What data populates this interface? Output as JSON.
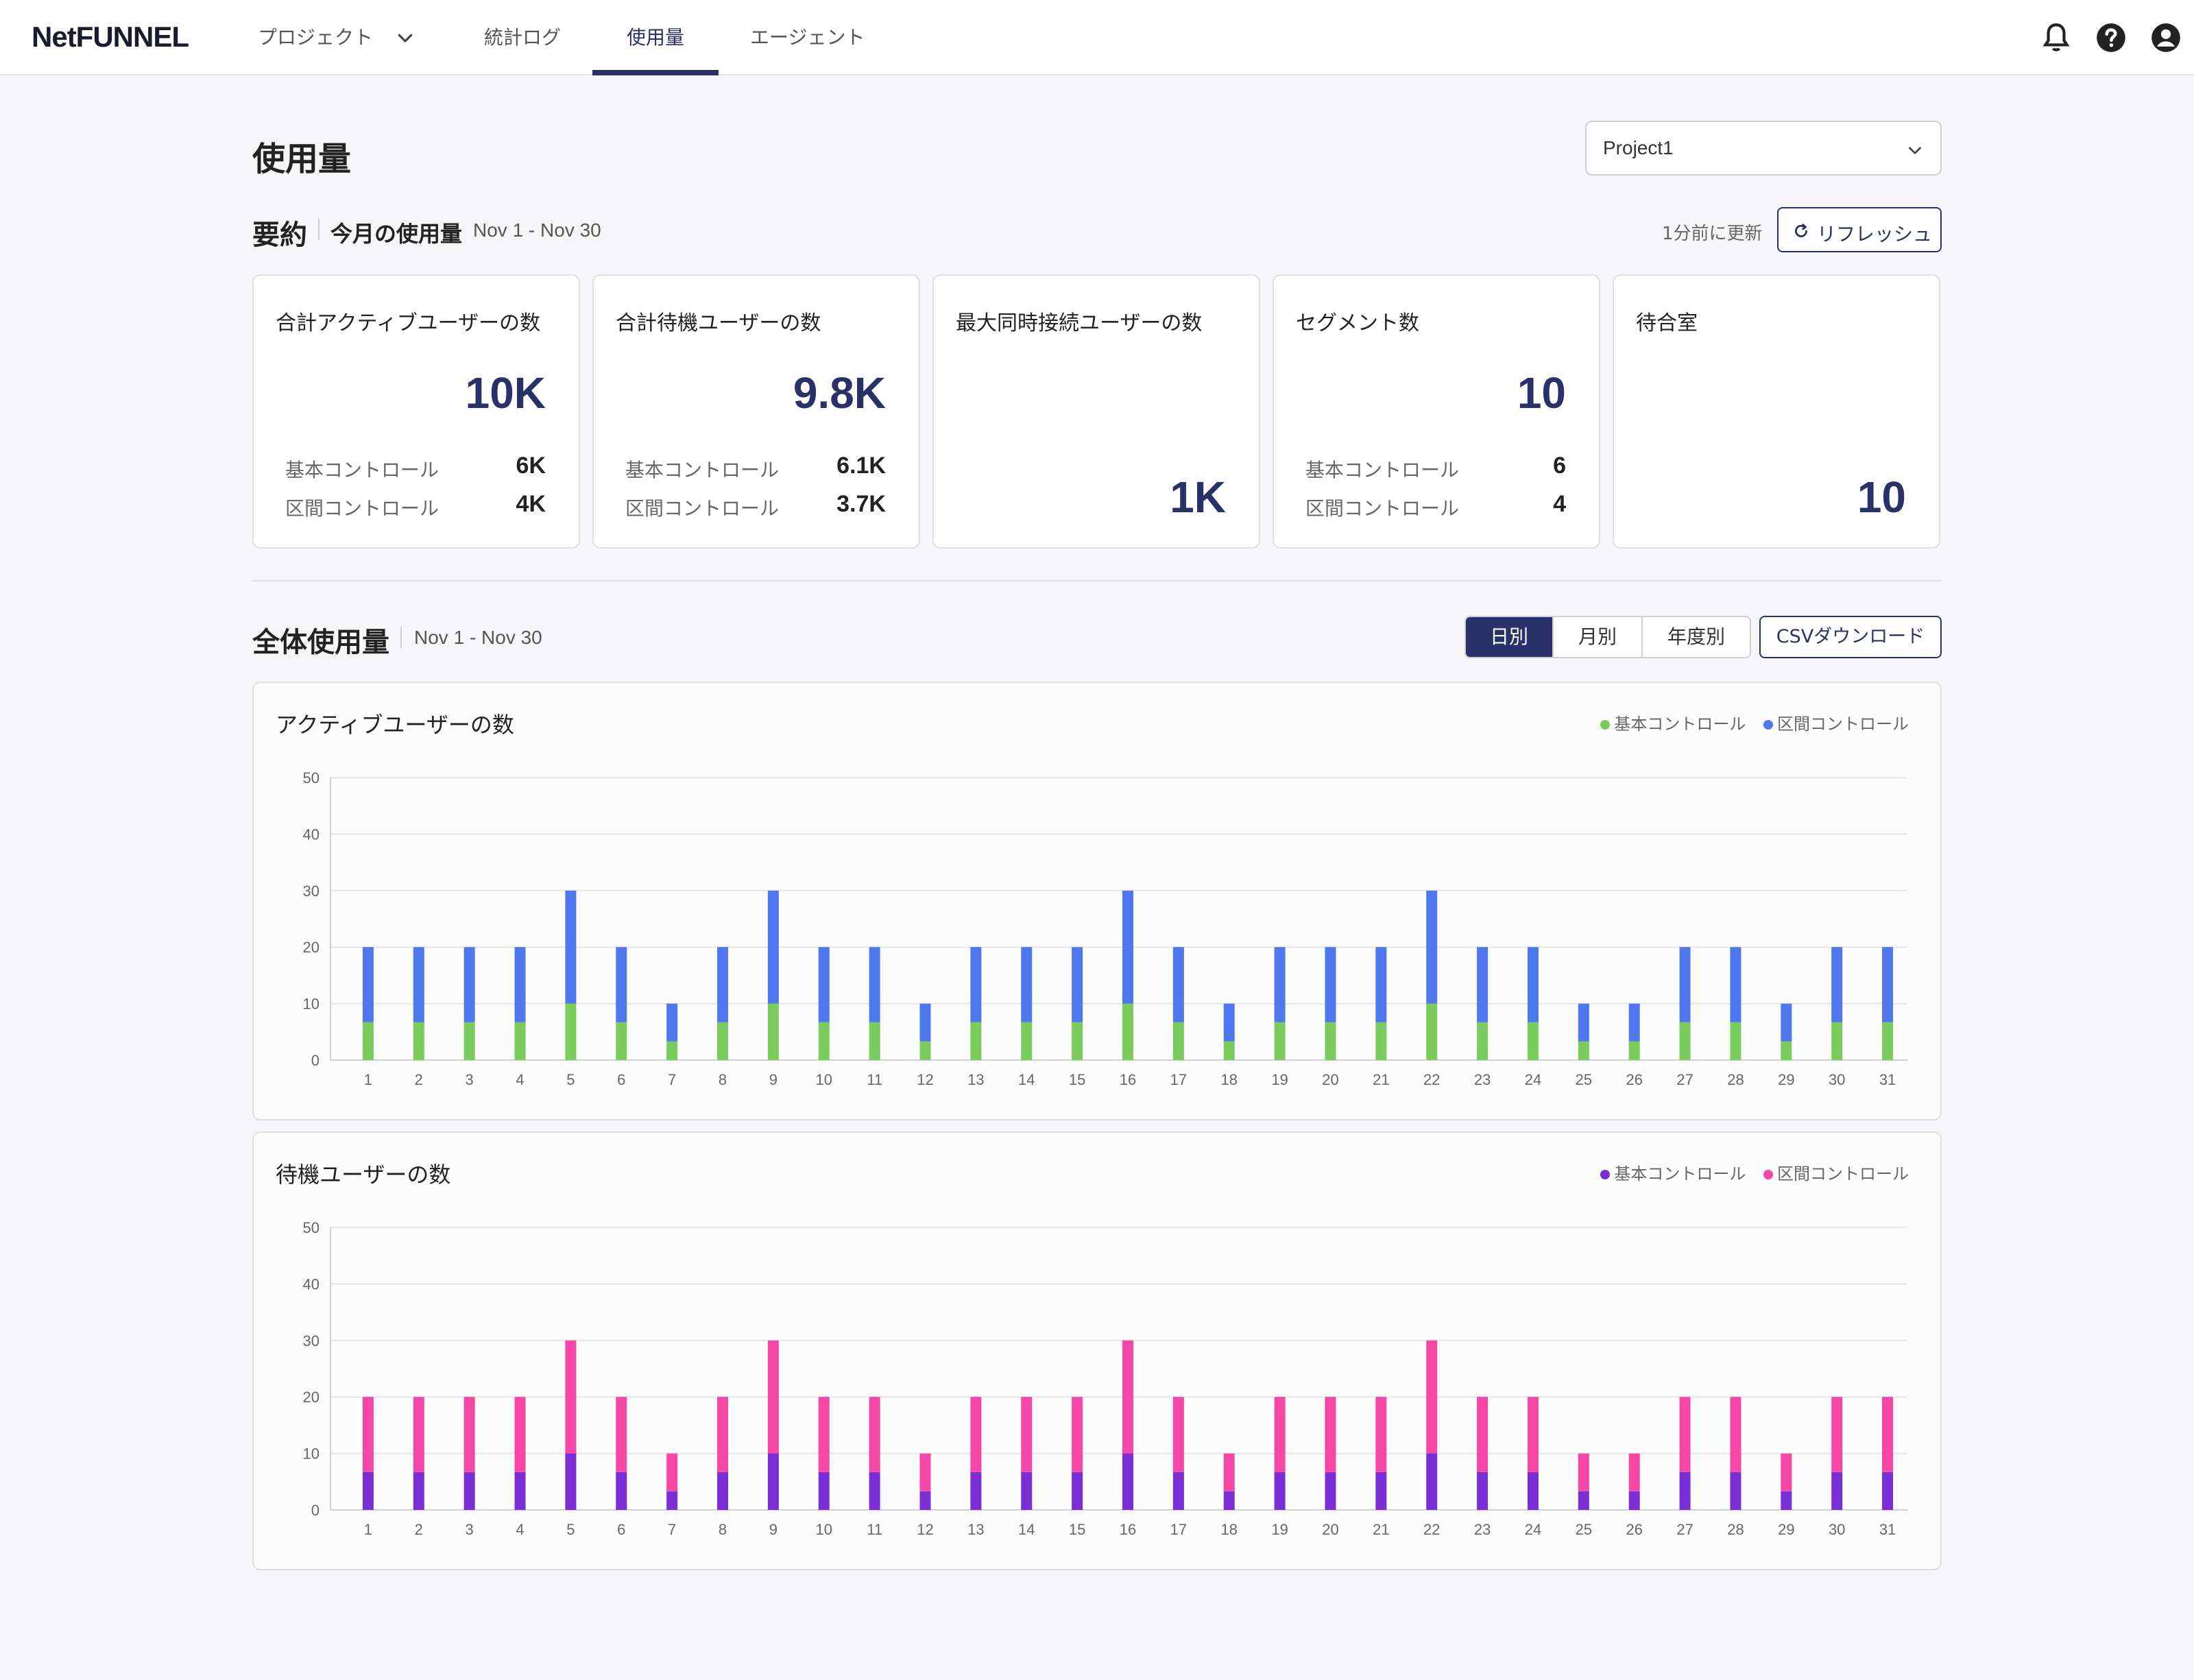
{
  "nav": {
    "logo": "NetFUNNEL",
    "items": [
      {
        "label": "プロジェクト",
        "left": 376
      },
      {
        "label": "統計ログ"
      },
      {
        "label": "使用量"
      },
      {
        "label": "エージェント"
      }
    ]
  },
  "page": {
    "title": "使用量",
    "project_select": "Project1"
  },
  "summary": {
    "heading": "要約",
    "sub": "今月の使用量",
    "range": "Nov 1 - Nov 30",
    "updated": "1分前に更新",
    "refresh_label": "リフレッシュ",
    "cards": [
      {
        "title": "合計アクティブユーザーの数",
        "value": "10K",
        "rows": [
          {
            "label": "基本コントロール",
            "value": "6K"
          },
          {
            "label": "区間コントロール",
            "value": "4K"
          }
        ]
      },
      {
        "title": "合計待機ユーザーの数",
        "value": "9.8K",
        "rows": [
          {
            "label": "基本コントロール",
            "value": "6.1K"
          },
          {
            "label": "区間コントロール",
            "value": "3.7K"
          }
        ]
      },
      {
        "title": "最大同時接続ユーザーの数",
        "value": "1K",
        "rows": []
      },
      {
        "title": "セグメント数",
        "value": "10",
        "rows": [
          {
            "label": "基本コントロール",
            "value": "6"
          },
          {
            "label": "区間コントロール",
            "value": "4"
          }
        ]
      },
      {
        "title": "待合室",
        "value": "10",
        "rows": []
      }
    ]
  },
  "overall": {
    "heading": "全体使用量",
    "range": "Nov 1 - Nov 30",
    "toggle": [
      "日別",
      "月別",
      "年度別"
    ],
    "csv_label": "CSVダウンロード"
  },
  "colors": {
    "accent": "#2a3168",
    "active_basic": "#7acc5c",
    "active_section": "#4f77ee",
    "wait_basic": "#7a2fd6",
    "wait_section": "#f646a6"
  },
  "chart_data": [
    {
      "type": "bar",
      "stacked": true,
      "title": "アクティブユーザーの数",
      "categories": [
        "1",
        "2",
        "3",
        "4",
        "5",
        "6",
        "7",
        "8",
        "9",
        "10",
        "11",
        "12",
        "13",
        "14",
        "15",
        "16",
        "17",
        "18",
        "19",
        "20",
        "21",
        "22",
        "23",
        "24",
        "25",
        "26",
        "27",
        "28",
        "29",
        "30",
        "31"
      ],
      "series": [
        {
          "name": "基本コントロール",
          "color": "#7acc5c",
          "values": [
            6.7,
            6.7,
            6.7,
            6.7,
            10,
            6.7,
            3.3,
            6.7,
            10,
            6.7,
            6.7,
            3.3,
            6.7,
            6.7,
            6.7,
            10,
            6.7,
            3.3,
            6.7,
            6.7,
            6.7,
            10,
            6.7,
            6.7,
            3.3,
            3.3,
            6.7,
            6.7,
            3.3,
            6.7,
            6.7
          ]
        },
        {
          "name": "区間コントロール",
          "color": "#4f77ee",
          "values": [
            13.3,
            13.3,
            13.3,
            13.3,
            20,
            13.3,
            6.7,
            13.3,
            20,
            13.3,
            13.3,
            6.7,
            13.3,
            13.3,
            13.3,
            20,
            13.3,
            6.7,
            13.3,
            13.3,
            13.3,
            20,
            13.3,
            13.3,
            6.7,
            6.7,
            13.3,
            13.3,
            6.7,
            13.3,
            13.3
          ]
        }
      ],
      "yticks": [
        0,
        10,
        20,
        30,
        40,
        50
      ],
      "ylim": [
        0,
        50
      ],
      "grid": true,
      "legend": "top-right"
    },
    {
      "type": "bar",
      "stacked": true,
      "title": "待機ユーザーの数",
      "categories": [
        "1",
        "2",
        "3",
        "4",
        "5",
        "6",
        "7",
        "8",
        "9",
        "10",
        "11",
        "12",
        "13",
        "14",
        "15",
        "16",
        "17",
        "18",
        "19",
        "20",
        "21",
        "22",
        "23",
        "24",
        "25",
        "26",
        "27",
        "28",
        "29",
        "30",
        "31"
      ],
      "series": [
        {
          "name": "基本コントロール",
          "color": "#7a2fd6",
          "values": [
            6.7,
            6.7,
            6.7,
            6.7,
            10,
            6.7,
            3.3,
            6.7,
            10,
            6.7,
            6.7,
            3.3,
            6.7,
            6.7,
            6.7,
            10,
            6.7,
            3.3,
            6.7,
            6.7,
            6.7,
            10,
            6.7,
            6.7,
            3.3,
            3.3,
            6.7,
            6.7,
            3.3,
            6.7,
            6.7
          ]
        },
        {
          "name": "区間コントロール",
          "color": "#f646a6",
          "values": [
            13.3,
            13.3,
            13.3,
            13.3,
            20,
            13.3,
            6.7,
            13.3,
            20,
            13.3,
            13.3,
            6.7,
            13.3,
            13.3,
            13.3,
            20,
            13.3,
            6.7,
            13.3,
            13.3,
            13.3,
            20,
            13.3,
            13.3,
            6.7,
            6.7,
            13.3,
            13.3,
            6.7,
            13.3,
            13.3
          ]
        }
      ],
      "yticks": [
        0,
        10,
        20,
        30,
        40,
        50
      ],
      "ylim": [
        0,
        50
      ],
      "grid": true,
      "legend": "top-right"
    }
  ]
}
